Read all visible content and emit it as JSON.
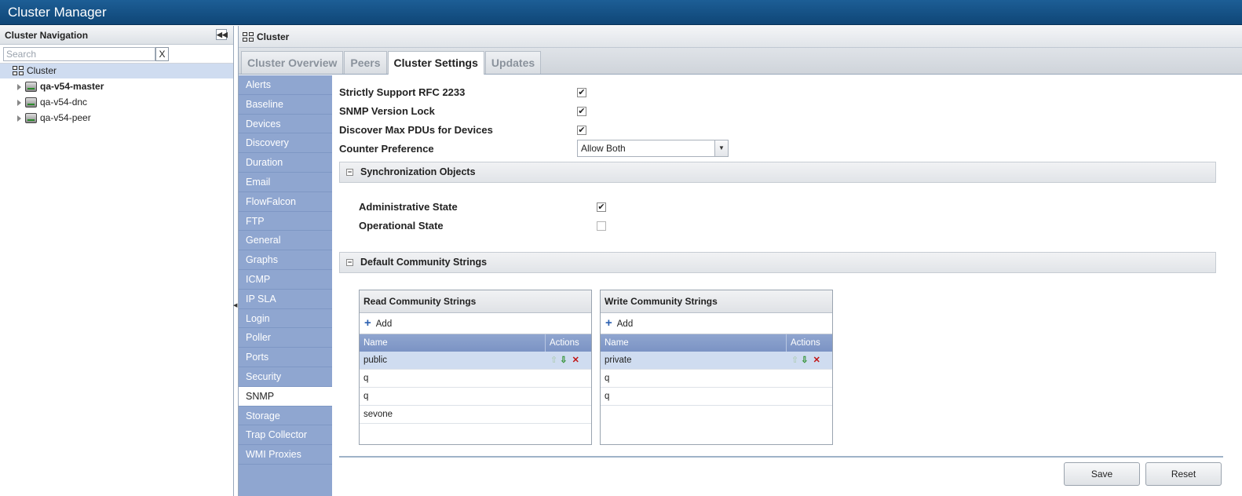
{
  "app": {
    "title": "Cluster Manager"
  },
  "nav": {
    "header": "Cluster Navigation",
    "search_placeholder": "Search",
    "clear_label": "X",
    "root": "Cluster",
    "nodes": [
      {
        "label": "qa-v54-master",
        "bold": true
      },
      {
        "label": "qa-v54-dnc",
        "bold": false
      },
      {
        "label": "qa-v54-peer",
        "bold": false
      }
    ]
  },
  "main": {
    "header": "Cluster",
    "tabs": [
      "Cluster Overview",
      "Peers",
      "Cluster Settings",
      "Updates"
    ],
    "active_tab": "Cluster Settings"
  },
  "settings_menu": {
    "items": [
      "Alerts",
      "Baseline",
      "Devices",
      "Discovery",
      "Duration",
      "Email",
      "FlowFalcon",
      "FTP",
      "General",
      "Graphs",
      "ICMP",
      "IP SLA",
      "Login",
      "Poller",
      "Ports",
      "Security",
      "SNMP",
      "Storage",
      "Trap Collector",
      "WMI Proxies"
    ],
    "active": "SNMP"
  },
  "snmp": {
    "rfc2233_label": "Strictly Support RFC 2233",
    "rfc2233_checked": true,
    "version_lock_label": "SNMP Version Lock",
    "version_lock_checked": true,
    "max_pdus_label": "Discover Max PDUs for Devices",
    "max_pdus_checked": true,
    "counter_pref_label": "Counter Preference",
    "counter_pref_value": "Allow Both",
    "sync_section": "Synchronization Objects",
    "admin_state_label": "Administrative State",
    "admin_state_checked": true,
    "oper_state_label": "Operational State",
    "oper_state_checked": false,
    "community_section": "Default Community Strings",
    "check_glyph": "✔",
    "minus_glyph": "−"
  },
  "read_grid": {
    "title": "Read Community Strings",
    "add_label": "Add",
    "col_name": "Name",
    "col_actions": "Actions",
    "rows": [
      "public",
      "q",
      "q",
      "sevone"
    ]
  },
  "write_grid": {
    "title": "Write Community Strings",
    "add_label": "Add",
    "col_name": "Name",
    "col_actions": "Actions",
    "rows": [
      "private",
      "q",
      "q"
    ]
  },
  "buttons": {
    "save": "Save",
    "reset": "Reset"
  },
  "colors": {
    "accent": "#0f4677",
    "menu": "#8fa6d0",
    "selected_row": "#cfdcf0"
  }
}
